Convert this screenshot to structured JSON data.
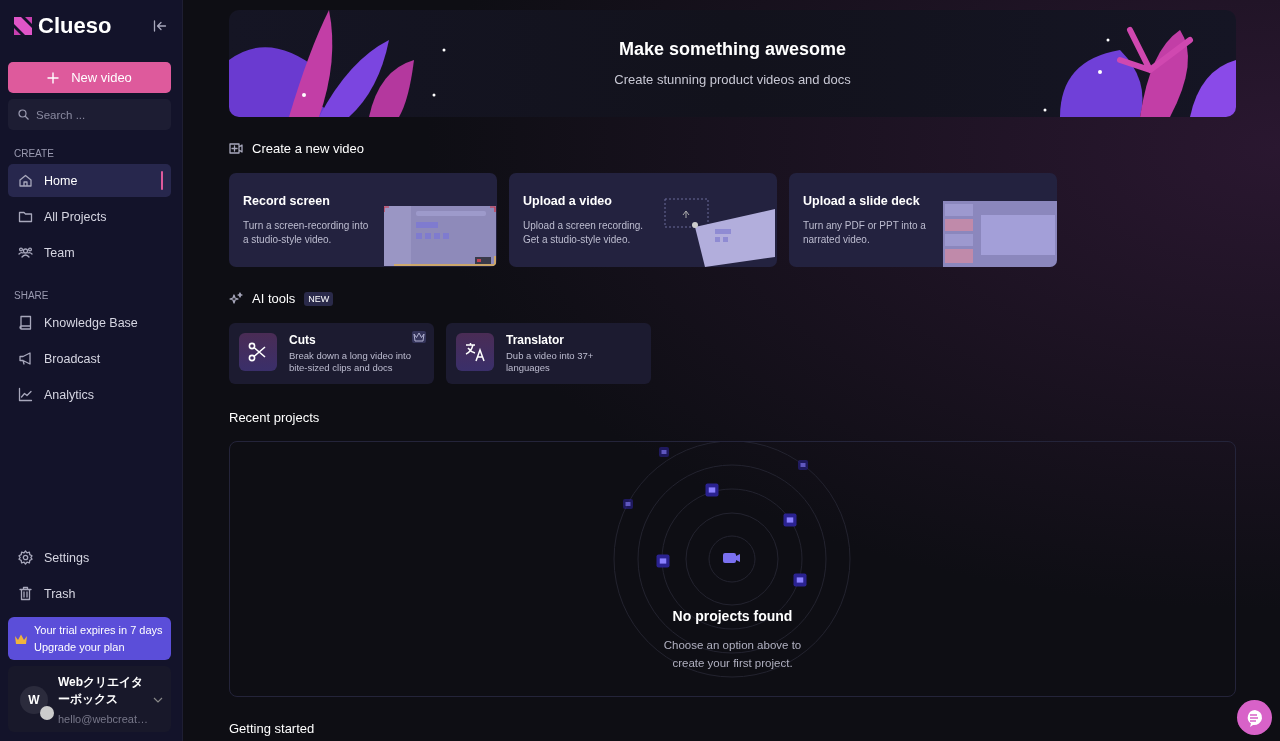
{
  "brand": {
    "name": "Clueso"
  },
  "sidebar": {
    "new_button": "New video",
    "search": {
      "placeholder": "Search ..."
    },
    "sections": [
      {
        "heading": "CREATE",
        "items": [
          {
            "label": "Home",
            "kind": "home",
            "selected": true
          },
          {
            "label": "All Projects",
            "kind": "folder",
            "selected": false
          },
          {
            "label": "Team",
            "kind": "team",
            "selected": false
          }
        ]
      },
      {
        "heading": "SHARE",
        "items": [
          {
            "label": "Knowledge Base",
            "kind": "book",
            "selected": false
          },
          {
            "label": "Broadcast",
            "kind": "megaphone",
            "selected": false
          },
          {
            "label": "Analytics",
            "kind": "chart",
            "selected": false
          }
        ]
      }
    ],
    "bottom_items": [
      {
        "label": "Settings",
        "kind": "gear",
        "selected": false
      },
      {
        "label": "Trash",
        "kind": "trash",
        "selected": false
      }
    ],
    "trial": {
      "message": "Your trial expires in 7 days",
      "link": "Upgrade your plan"
    },
    "user": {
      "avatar": "W",
      "name": "Webクリエイターボックス",
      "email": "hello@webcreat…"
    }
  },
  "hero": {
    "title": "Make something awesome",
    "subtitle": "Create stunning product videos and docs"
  },
  "create": {
    "title": "Create a new video",
    "cards": [
      {
        "kind": "record",
        "title": "Record screen",
        "description": "Turn a screen-recording into a studio-style video."
      },
      {
        "kind": "upload",
        "title": "Upload a video",
        "description": "Upload a screen recording. Get a studio-style video."
      },
      {
        "kind": "slides",
        "title": "Upload a slide deck",
        "description": "Turn any PDF or PPT into a narrated video."
      }
    ]
  },
  "ai_tools": {
    "title": "AI tools",
    "badge": "NEW",
    "tools": [
      {
        "kind": "cuts",
        "name": "Cuts",
        "description": "Break down a long video into bite-sized clips and docs",
        "premium": true
      },
      {
        "kind": "translator",
        "name": "Translator",
        "description": "Dub a video into 37+ languages",
        "premium": false
      }
    ]
  },
  "recent": {
    "title": "Recent projects",
    "empty_title": "No projects found",
    "empty_text": "Choose an option above to create your first project."
  },
  "next_section": {
    "title": "Getting started"
  }
}
